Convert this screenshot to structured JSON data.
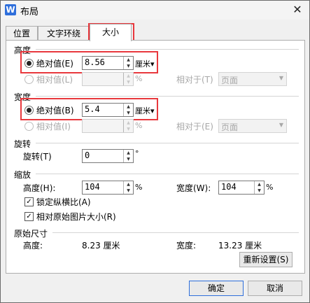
{
  "window": {
    "title": "布局",
    "app_icon_letter": "W",
    "close_glyph": "✕"
  },
  "tabs": [
    {
      "label": "位置"
    },
    {
      "label": "文字环绕"
    },
    {
      "label": "大小"
    }
  ],
  "height_section": {
    "title": "高度",
    "absolute_label": "绝对值(E)",
    "absolute_value": "8.56",
    "absolute_unit": "厘米▾",
    "relative_label": "相对值(L)",
    "relative_unit": "%",
    "relative_to_label": "相对于(T)",
    "relative_to_value": "页面"
  },
  "width_section": {
    "title": "宽度",
    "absolute_label": "绝对值(B)",
    "absolute_value": "5.4",
    "absolute_unit": "厘米▾",
    "relative_label": "相对值(I)",
    "relative_unit": "%",
    "relative_to_label": "相对于(E)",
    "relative_to_value": "页面"
  },
  "rotate_section": {
    "title": "旋转",
    "rotate_label": "旋转(T)",
    "rotate_value": "0",
    "rotate_unit": "°"
  },
  "scale_section": {
    "title": "缩放",
    "height_label": "高度(H):",
    "height_value": "104",
    "height_unit": "%",
    "width_label": "宽度(W):",
    "width_value": "104",
    "width_unit": "%",
    "lock_aspect_label": "锁定纵横比(A)",
    "relative_original_label": "相对原始图片大小(R)"
  },
  "original_section": {
    "title": "原始尺寸",
    "height_label": "高度:",
    "height_value": "8.23 厘米",
    "width_label": "宽度:",
    "width_value": "13.23 厘米",
    "reset_button": "重新设置(S)"
  },
  "footer": {
    "ok_button": "确定",
    "cancel_button": "取消"
  },
  "spin_up": "▲",
  "spin_down": "▼",
  "dropdown_arrow": "▼",
  "check_mark": "✓",
  "colors": {
    "highlight": "#e8383d",
    "accent": "#2f6fdb"
  }
}
